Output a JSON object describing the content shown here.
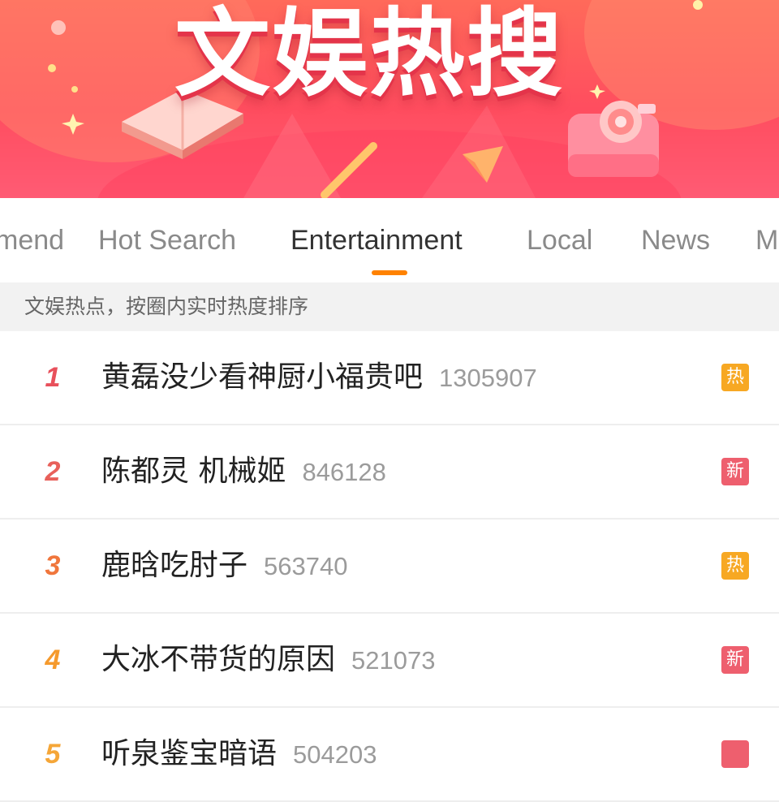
{
  "banner": {
    "title": "文娱热搜"
  },
  "tabs": [
    {
      "label": "mend"
    },
    {
      "label": "Hot Search"
    },
    {
      "label": "Entertainment",
      "active": true
    },
    {
      "label": "Local"
    },
    {
      "label": "News"
    },
    {
      "label": "M"
    }
  ],
  "subheader": {
    "text": "文娱热点，按圈内实时热度排序"
  },
  "colors": {
    "accent": "#ff8200",
    "hot_badge": "#f7a823",
    "new_badge": "#ee5f6e"
  },
  "items": [
    {
      "rank": "1",
      "title": "黄磊没少看神厨小福贵吧",
      "count": "1305907",
      "badge": "热",
      "badge_type": "hot"
    },
    {
      "rank": "2",
      "title": "陈都灵 机械姬",
      "count": "846128",
      "badge": "新",
      "badge_type": "new"
    },
    {
      "rank": "3",
      "title": "鹿晗吃肘子",
      "count": "563740",
      "badge": "热",
      "badge_type": "hot"
    },
    {
      "rank": "4",
      "title": "大冰不带货的原因",
      "count": "521073",
      "badge": "新",
      "badge_type": "new"
    },
    {
      "rank": "5",
      "title": "听泉鉴宝暗语",
      "count": "504203",
      "badge": "",
      "badge_type": "new"
    }
  ]
}
